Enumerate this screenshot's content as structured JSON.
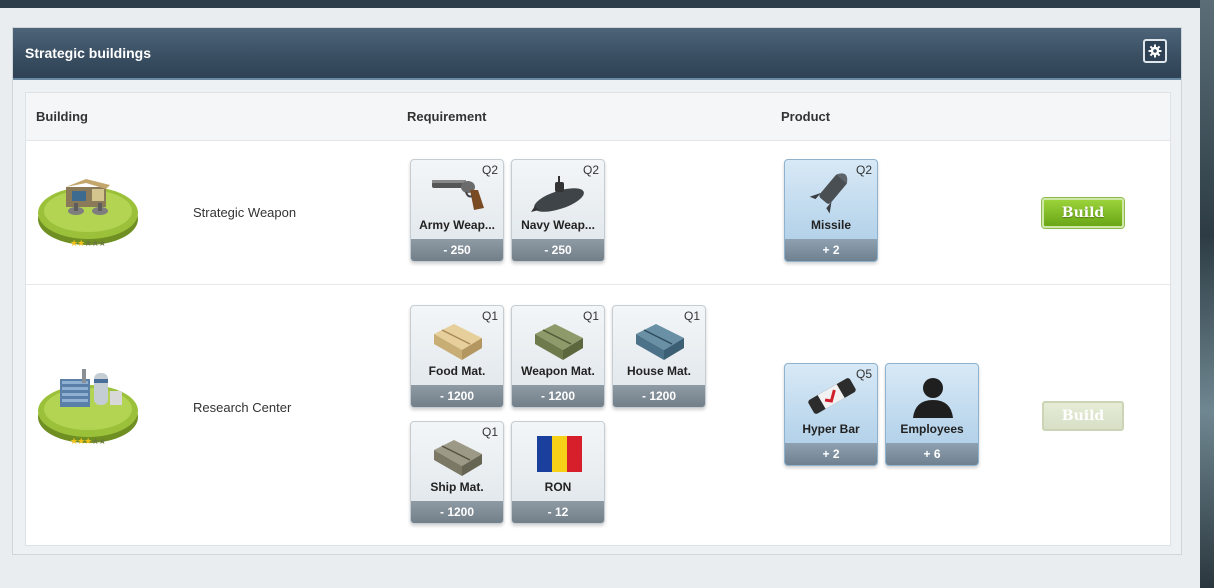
{
  "panel": {
    "title": "Strategic buildings",
    "settings_icon": "gear-icon"
  },
  "table": {
    "headers": {
      "building": "Building",
      "requirement": "Requirement",
      "product": "Product"
    }
  },
  "rows": [
    {
      "building": "Strategic Weapon",
      "building_stars": 2,
      "requirements": [
        {
          "name": "Army Weap...",
          "quality": "Q2",
          "amount": "- 250",
          "icon": "revolver-icon"
        },
        {
          "name": "Navy Weap...",
          "quality": "Q2",
          "amount": "- 250",
          "icon": "submarine-icon"
        }
      ],
      "products": [
        {
          "name": "Missile",
          "quality": "Q2",
          "amount": "+ 2",
          "icon": "missile-icon"
        }
      ],
      "action": {
        "label": "Build",
        "enabled": true
      }
    },
    {
      "building": "Research Center",
      "building_stars": 3,
      "requirements": [
        {
          "name": "Food Mat.",
          "quality": "Q1",
          "amount": "- 1200",
          "icon": "crate-icon"
        },
        {
          "name": "Weapon Mat.",
          "quality": "Q1",
          "amount": "- 1200",
          "icon": "crate-icon"
        },
        {
          "name": "House Mat.",
          "quality": "Q1",
          "amount": "- 1200",
          "icon": "crate-icon"
        },
        {
          "name": "Ship Mat.",
          "quality": "Q1",
          "amount": "- 1200",
          "icon": "crate-icon"
        },
        {
          "name": "RON",
          "quality": "",
          "amount": "- 12",
          "icon": "flag-icon"
        }
      ],
      "products": [
        {
          "name": "Hyper Bar",
          "quality": "Q5",
          "amount": "+ 2",
          "icon": "energy-bar-icon"
        },
        {
          "name": "Employees",
          "quality": "",
          "amount": "+ 6",
          "icon": "person-icon"
        }
      ],
      "action": {
        "label": "Build",
        "enabled": false
      }
    }
  ],
  "colors": {
    "header_bg": "#3a4f62",
    "build_active": "#7fbf22",
    "build_disabled": "#d8e0c8"
  }
}
